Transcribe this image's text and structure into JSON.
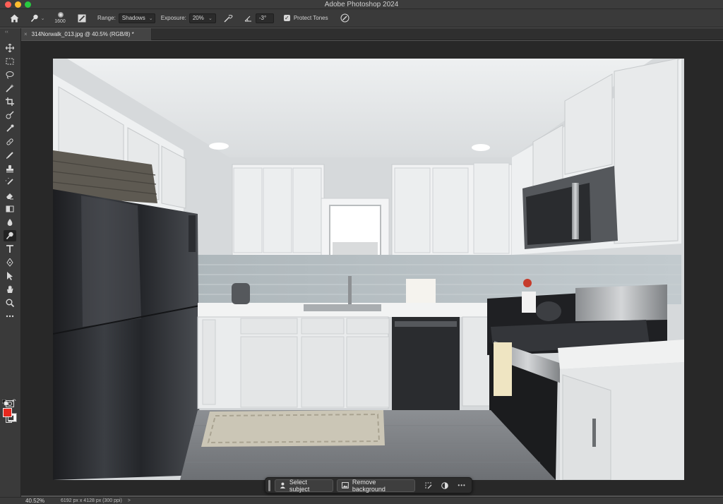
{
  "window": {
    "app_title": "Adobe Photoshop 2024"
  },
  "options_bar": {
    "brush_size": "1600",
    "range_label": "Range:",
    "range_value": "Shadows",
    "exposure_label": "Exposure:",
    "exposure_value": "20%",
    "angle_value": "-3°",
    "protect_tones_label": "Protect Tones",
    "protect_tones_checked": true
  },
  "document_tab": {
    "title": "314Norwalk_013.jpg @ 40.5% (RGB/8) *",
    "close_glyph": "×"
  },
  "toolbar": {
    "tools": [
      {
        "name": "move-tool-icon"
      },
      {
        "name": "rectangular-marquee-icon"
      },
      {
        "name": "lasso-icon"
      },
      {
        "name": "magic-wand-icon"
      },
      {
        "name": "crop-icon"
      },
      {
        "name": "frame-icon"
      },
      {
        "name": "eyedropper-icon"
      },
      {
        "name": "spot-healing-icon"
      },
      {
        "name": "brush-icon"
      },
      {
        "name": "clone-stamp-icon"
      },
      {
        "name": "history-brush-icon"
      },
      {
        "name": "eraser-icon"
      },
      {
        "name": "gradient-icon"
      },
      {
        "name": "blur-icon"
      },
      {
        "name": "dodge-icon",
        "active": true
      },
      {
        "name": "type-icon"
      },
      {
        "name": "pen-icon"
      },
      {
        "name": "path-selection-icon"
      },
      {
        "name": "hand-icon"
      },
      {
        "name": "zoom-icon"
      },
      {
        "name": "more-tools-icon"
      }
    ],
    "colors": {
      "foreground": "#e8281e",
      "background": "#ffffff"
    }
  },
  "status_bar": {
    "zoom": "40.52%",
    "doc_info": "6192 px x 4128 px (300 ppi)",
    "caret": ">"
  },
  "task_bar": {
    "select_subject_label": "Select subject",
    "remove_background_label": "Remove background",
    "more_glyph": "•••"
  }
}
